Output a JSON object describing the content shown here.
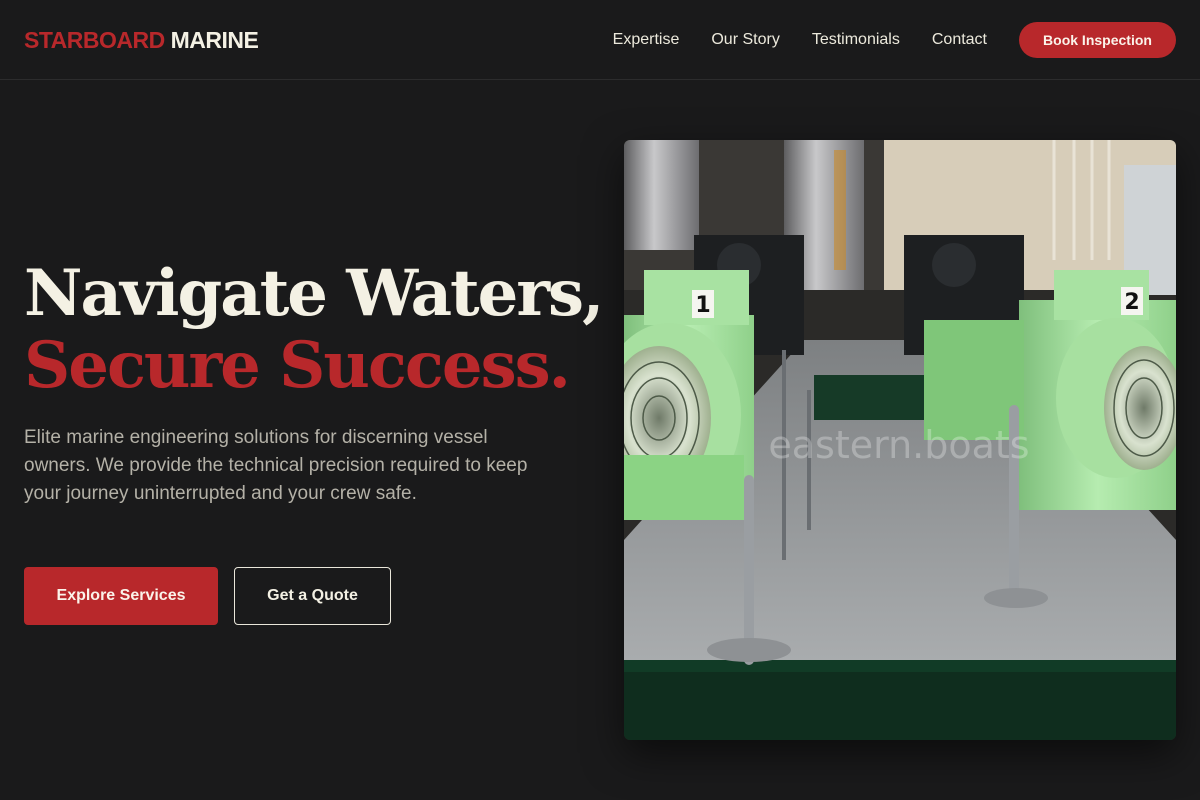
{
  "brand": {
    "name_accent": "STARBOARD",
    "name_main": "MARINE"
  },
  "nav": {
    "items": [
      "Expertise",
      "Our Story",
      "Testimonials",
      "Contact"
    ],
    "cta": "Book Inspection"
  },
  "hero": {
    "headline_line1": "Navigate Waters,",
    "headline_line2": "Secure Success.",
    "description": "Elite marine engineering solutions for discerning vessel owners. We provide the technical precision required to keep your journey uninterrupted and your crew safe.",
    "primary_button": "Explore Services",
    "secondary_button": "Get a Quote"
  },
  "image": {
    "subject": "ship engine room with two green electric motor compressors",
    "motor_labels": [
      "1",
      "2"
    ],
    "watermark": "eastern.boats"
  },
  "colors": {
    "background": "#1a1a1b",
    "accent": "#b8282b",
    "text_primary": "#f4f1e4",
    "text_muted": "#b4b1a7"
  }
}
